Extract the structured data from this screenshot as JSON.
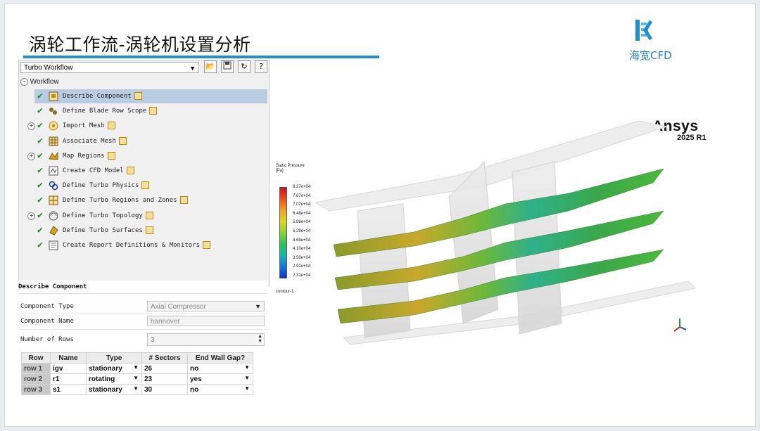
{
  "slide": {
    "title": "涡轮工作流-涡轮机设置分析",
    "logo_text": "海宽CFD",
    "brand": "Ansys",
    "version": "2025 R1",
    "accent": "#1e8fd0"
  },
  "workflow_panel": {
    "combo_value": "Turbo Workflow",
    "toolbar_icons": [
      "open-folder-icon",
      "save-icon",
      "refresh-icon",
      "help-icon"
    ],
    "root_label": "Workflow",
    "items": [
      {
        "label": "Describe Component",
        "selected": true,
        "icon": "component-icon",
        "expandable": false
      },
      {
        "label": "Define Blade Row Scope",
        "icon": "blade-row-icon",
        "expandable": false
      },
      {
        "label": "Import Mesh",
        "icon": "mesh-import-icon",
        "expandable": true
      },
      {
        "label": "Associate Mesh",
        "icon": "associate-mesh-icon",
        "expandable": false
      },
      {
        "label": "Map Regions",
        "icon": "map-regions-icon",
        "expandable": true
      },
      {
        "label": "Create CFD Model",
        "icon": "cfd-model-icon",
        "expandable": false
      },
      {
        "label": "Define Turbo Physics",
        "icon": "physics-icon",
        "expandable": false
      },
      {
        "label": "Define Turbo Regions and Zones",
        "icon": "regions-zones-icon",
        "expandable": false
      },
      {
        "label": "Define Turbo Topology",
        "icon": "topology-icon",
        "expandable": true
      },
      {
        "label": "Define Turbo Surfaces",
        "icon": "surfaces-icon",
        "expandable": false
      },
      {
        "label": "Create Report Definitions & Monitors",
        "icon": "report-icon",
        "expandable": false
      }
    ]
  },
  "describe": {
    "title": "Describe Component",
    "component_type_label": "Component Type",
    "component_type_value": "Axial Compressor",
    "component_name_label": "Component Name",
    "component_name_value": "hannover",
    "rows_label": "Number of Rows",
    "rows_value": "3",
    "table": {
      "headers": [
        "Row",
        "Name",
        "Type",
        "# Sectors",
        "End Wall Gap?"
      ],
      "rows": [
        [
          "row 1",
          "igv",
          "stationary",
          "26",
          "no"
        ],
        [
          "row 2",
          "r1",
          "rotating",
          "23",
          "yes"
        ],
        [
          "row 3",
          "s1",
          "stationary",
          "30",
          "no"
        ]
      ]
    }
  },
  "legend": {
    "title_line1": "Static Pressure",
    "title_line2": "[Pa]",
    "ticks": [
      "8.27e+04",
      "7.67e+04",
      "7.07e+04",
      "6.48e+04",
      "5.88e+04",
      "5.29e+04",
      "4.69e+04",
      "4.10e+04",
      "3.50e+04",
      "2.91e+04",
      "2.31e+04"
    ],
    "contour_label": "contour-1"
  }
}
